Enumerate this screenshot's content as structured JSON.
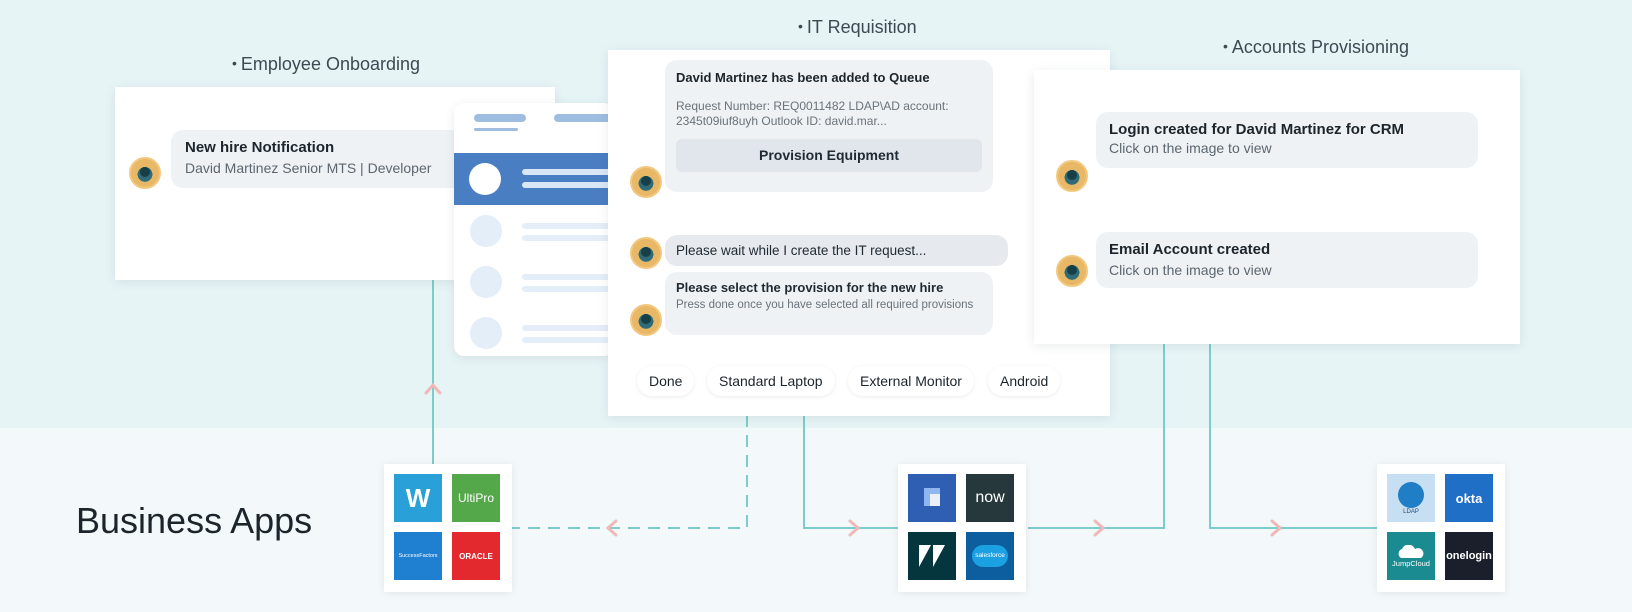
{
  "sections": {
    "onboarding": "Employee Onboarding",
    "requisition": "IT Requisition",
    "provisioning": "Accounts Provisioning"
  },
  "onboarding_card": {
    "title": "New hire Notification",
    "subtitle": "David Martinez Senior MTS | Developer"
  },
  "requisition_card": {
    "queue_title": "David Martinez has been added to Queue",
    "request_details": "Request Number: REQ0011482 LDAP\\AD account: 2345t09iuf8uyh Outlook ID: david.mar...",
    "provision_button": "Provision Equipment",
    "wait_message": "Please wait while I create the IT request...",
    "select_title": "Please select the provision for the new hire",
    "select_sub": "Press done once you have selected all required provisions",
    "options": [
      "Done",
      "Standard Laptop",
      "External Monitor",
      "Android"
    ]
  },
  "provisioning_card": {
    "login_title": "Login created for David Martinez for CRM",
    "login_sub": "Click on the image to view",
    "email_title": "Email Account created",
    "email_sub": "Click on the image to view"
  },
  "business_apps_label": "Business Apps",
  "apps": {
    "hr": [
      "W",
      "UltiPro",
      "SuccessFactors",
      "ORACLE"
    ],
    "itsm": [
      "",
      "now",
      "",
      "salesforce"
    ],
    "identity": [
      "LDAP",
      "okta",
      "JumpCloud",
      "onelogin"
    ]
  },
  "colors": {
    "connector": "#7ccccc",
    "arrow": "#f1b8b8",
    "top_bg": "#e6f4f6",
    "accent_blue": "#4a7ec2"
  }
}
